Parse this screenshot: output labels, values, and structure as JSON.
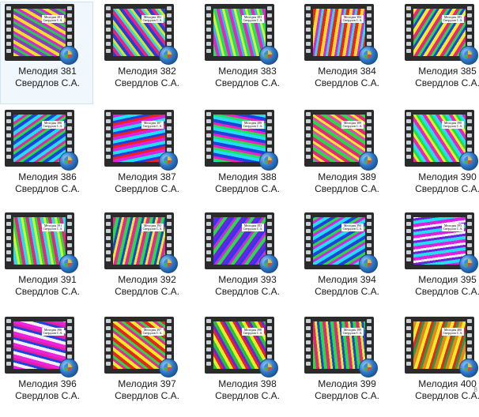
{
  "items": [
    {
      "title": "Мелодия 381",
      "author": "Свердлов С.А.",
      "c": [
        "#f0e020",
        "#8a3cc8",
        "#20d040",
        "#e020e0"
      ]
    },
    {
      "title": "Мелодия 382",
      "author": "Свердлов С.А.",
      "c": [
        "#2040e0",
        "#f02080",
        "#20e0e0",
        "#e0e020"
      ]
    },
    {
      "title": "Мелодия 383",
      "author": "Свердлов С.А.",
      "c": [
        "#20e060",
        "#f020c0",
        "#20c0f0",
        "#e0f020"
      ]
    },
    {
      "title": "Мелодия 384",
      "author": "Свердлов С.А.",
      "c": [
        "#f02020",
        "#f0e020",
        "#e020e0",
        "#20e0f0"
      ]
    },
    {
      "title": "Мелодия 385",
      "author": "Свердлов С.А.",
      "c": [
        "#f0f020",
        "#f02080",
        "#20e040",
        "#2040f0"
      ]
    },
    {
      "title": "Мелодия 386",
      "author": "Свердлов С.А.",
      "c": [
        "#2040e0",
        "#20e0f0",
        "#f020a0",
        "#20e040"
      ]
    },
    {
      "title": "Мелодия 387",
      "author": "Свердлов С.А.",
      "c": [
        "#e020e0",
        "#20e0f0",
        "#2040e0",
        "#f02020"
      ]
    },
    {
      "title": "Мелодия 388",
      "author": "Свердлов С.А.",
      "c": [
        "#20e0f0",
        "#2040e0",
        "#f020c0",
        "#20e060"
      ]
    },
    {
      "title": "Мелодия 389",
      "author": "Свердлов С.А.",
      "c": [
        "#20e040",
        "#f02080",
        "#e0f020",
        "#f040c0"
      ]
    },
    {
      "title": "Мелодия 390",
      "author": "Свердлов С.А.",
      "c": [
        "#f020c0",
        "#20e0f0",
        "#20e040",
        "#e0f020"
      ]
    },
    {
      "title": "Мелодия 391",
      "author": "Свердлов С.А.",
      "c": [
        "#20e0f0",
        "#f02080",
        "#20e040",
        "#e0f020"
      ]
    },
    {
      "title": "Мелодия 392",
      "author": "Свердлов С.А.",
      "c": [
        "#20e040",
        "#f020a0",
        "#e0f020",
        "#2040e0"
      ]
    },
    {
      "title": "Мелодия 393",
      "author": "Свердлов С.А.",
      "c": [
        "#7020e0",
        "#20e040",
        "#e020e0",
        "#2040f0"
      ]
    },
    {
      "title": "Мелодия 394",
      "author": "Свердлов С.А.",
      "c": [
        "#2040e0",
        "#20e0f0",
        "#e020e0",
        "#20e040"
      ]
    },
    {
      "title": "Мелодия 395",
      "author": "Свердлов С.А.",
      "c": [
        "#e020e0",
        "#20e0f0",
        "#7020e0",
        "#f0f0f0"
      ]
    },
    {
      "title": "Мелодия 396",
      "author": "Свердлов С.А.",
      "c": [
        "#f020e0",
        "#f0f0f0",
        "#2040e0",
        "#e020a0"
      ]
    },
    {
      "title": "Мелодия 397",
      "author": "Свердлов С.А.",
      "c": [
        "#f02020",
        "#e0f020",
        "#f020a0",
        "#20e040"
      ]
    },
    {
      "title": "Мелодия 398",
      "author": "Свердлов С.А.",
      "c": [
        "#20c040",
        "#e0f020",
        "#f02020",
        "#7020e0"
      ]
    },
    {
      "title": "Мелодия 399",
      "author": "Свердлов С.А.",
      "c": [
        "#20e040",
        "#f02080",
        "#e0f020",
        "#2040e0"
      ]
    },
    {
      "title": "Мелодия 400",
      "author": "Свердлов С.А.",
      "c": [
        "#f08020",
        "#e0f020",
        "#f02020",
        "#20a040"
      ]
    }
  ],
  "label_text": "Мелодия\nСвердлов С.А.",
  "scroll_mark": "8"
}
